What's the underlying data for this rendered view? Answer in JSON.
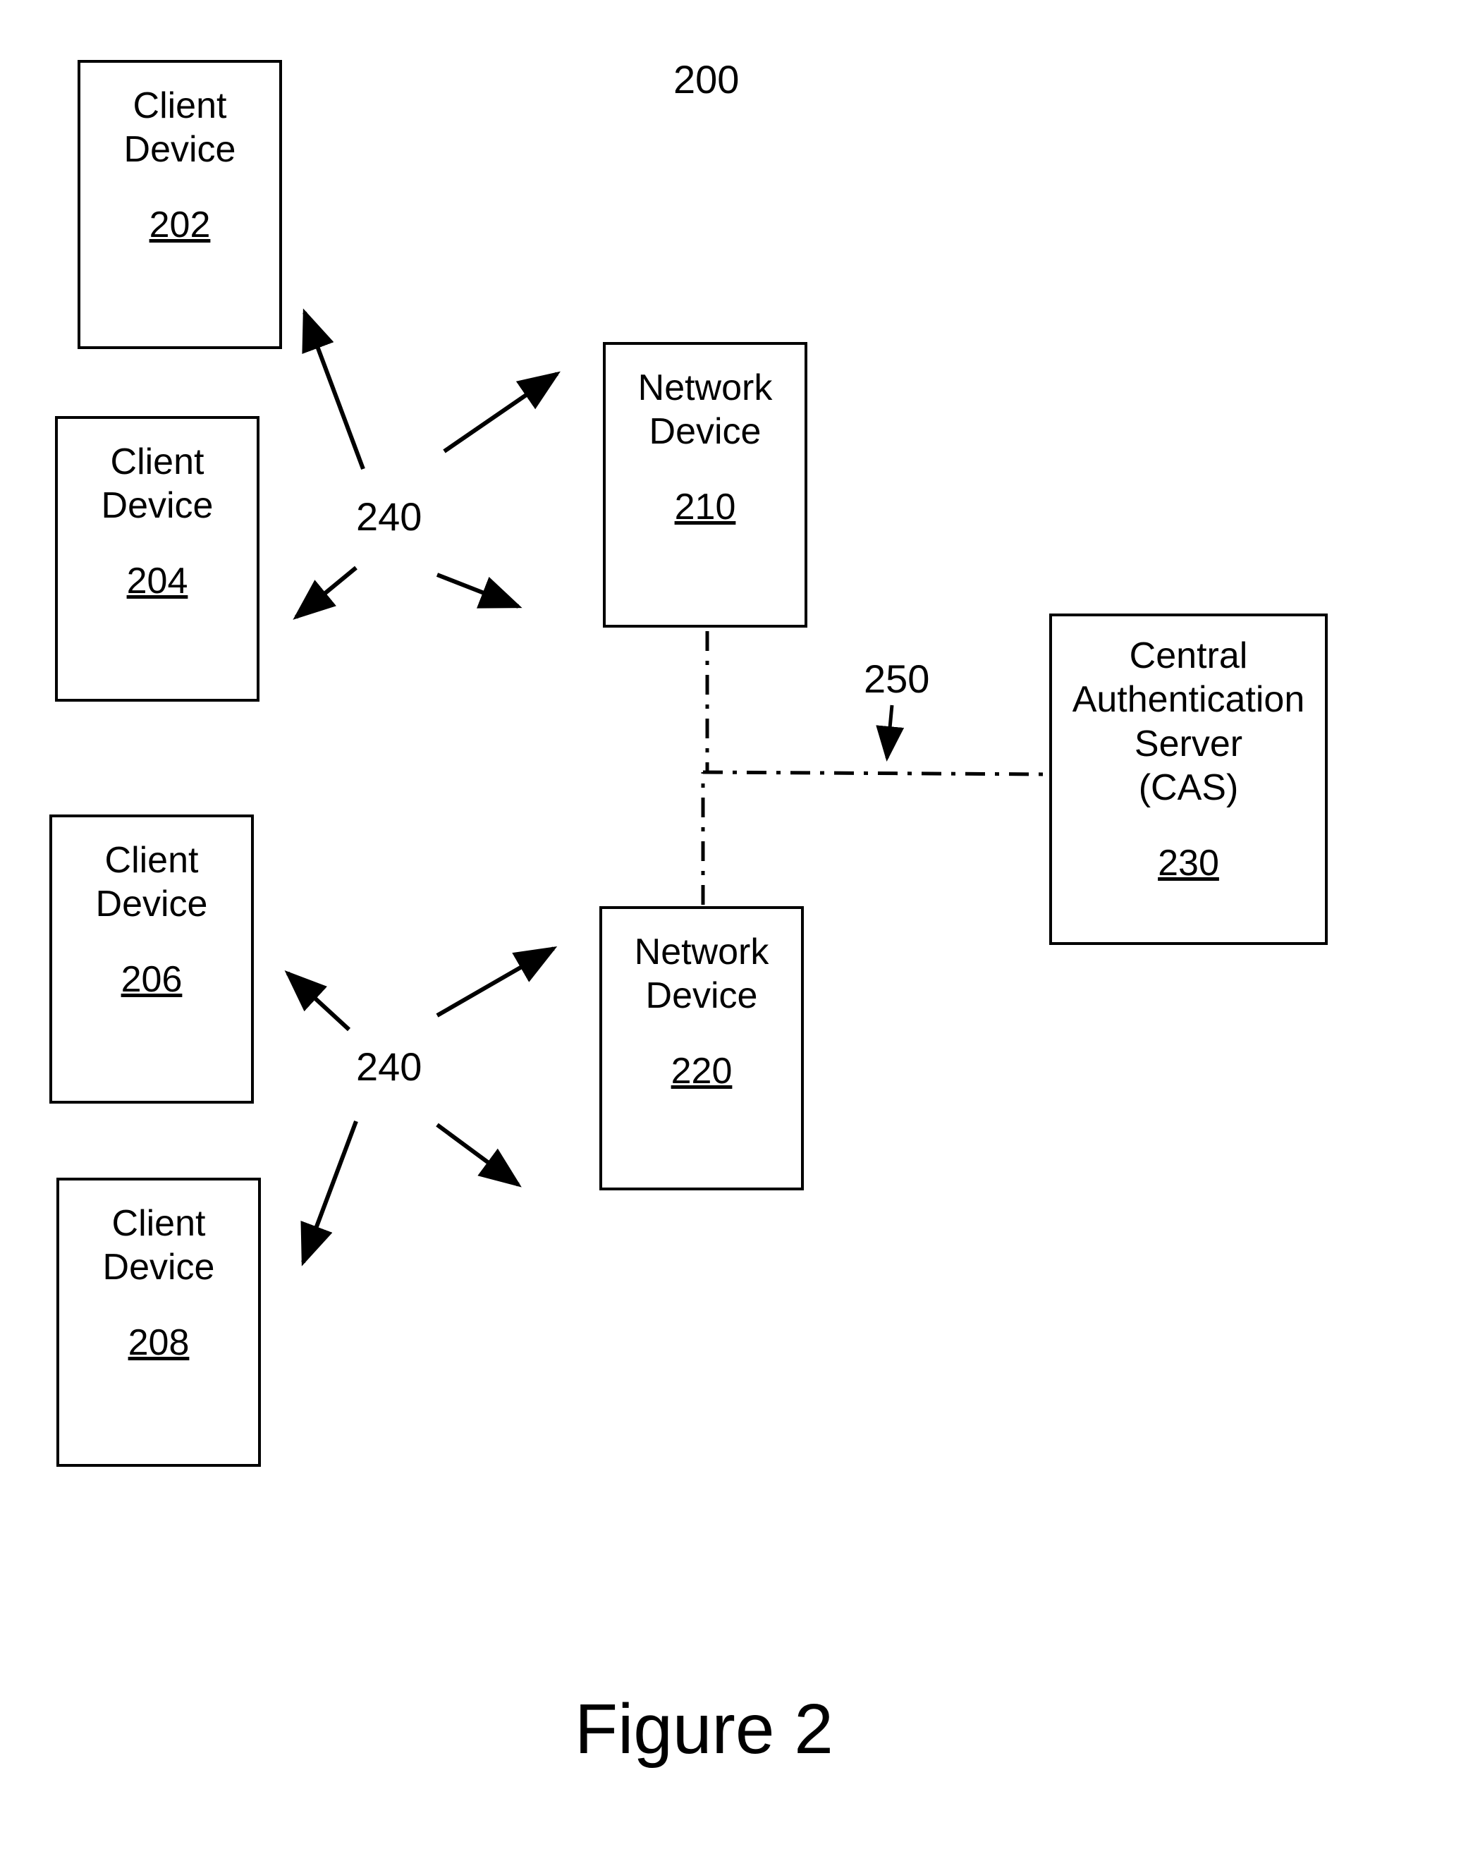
{
  "figure": {
    "caption": "Figure 2",
    "ref_number": "200"
  },
  "boxes": {
    "client1": {
      "label_line1": "Client",
      "label_line2": "Device",
      "ref": "202"
    },
    "client2": {
      "label_line1": "Client",
      "label_line2": "Device",
      "ref": "204"
    },
    "client3": {
      "label_line1": "Client",
      "label_line2": "Device",
      "ref": "206"
    },
    "client4": {
      "label_line1": "Client",
      "label_line2": "Device",
      "ref": "208"
    },
    "network1": {
      "label_line1": "Network",
      "label_line2": "Device",
      "ref": "210"
    },
    "network2": {
      "label_line1": "Network",
      "label_line2": "Device",
      "ref": "220"
    },
    "cas": {
      "label_line1": "Central",
      "label_line2": "Authentication",
      "label_line3": "Server",
      "label_line4": "(CAS)",
      "ref": "230"
    }
  },
  "labels": {
    "wireless1": "240",
    "wireless2": "240",
    "wired": "250"
  }
}
